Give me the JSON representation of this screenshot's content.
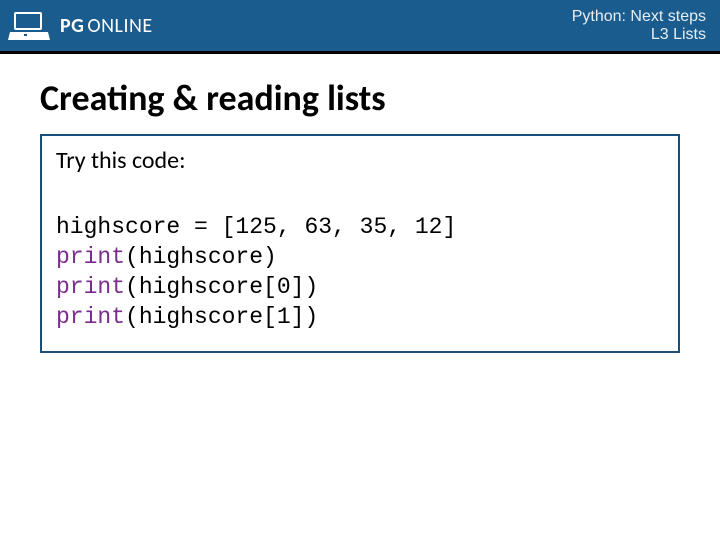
{
  "header": {
    "brand_pg": "PG",
    "brand_online": "ONLINE",
    "course_title": "Python: Next steps",
    "lesson": "L3 Lists"
  },
  "slide": {
    "title": "Creating & reading lists",
    "intro": "Try this code:",
    "code": {
      "line1_var": "highscore = [125, 63, 35, 12]",
      "print_kw": "print",
      "line2_arg": "(highscore)",
      "line3_arg": "(highscore[0])",
      "line4_arg": "(highscore[1])"
    }
  }
}
